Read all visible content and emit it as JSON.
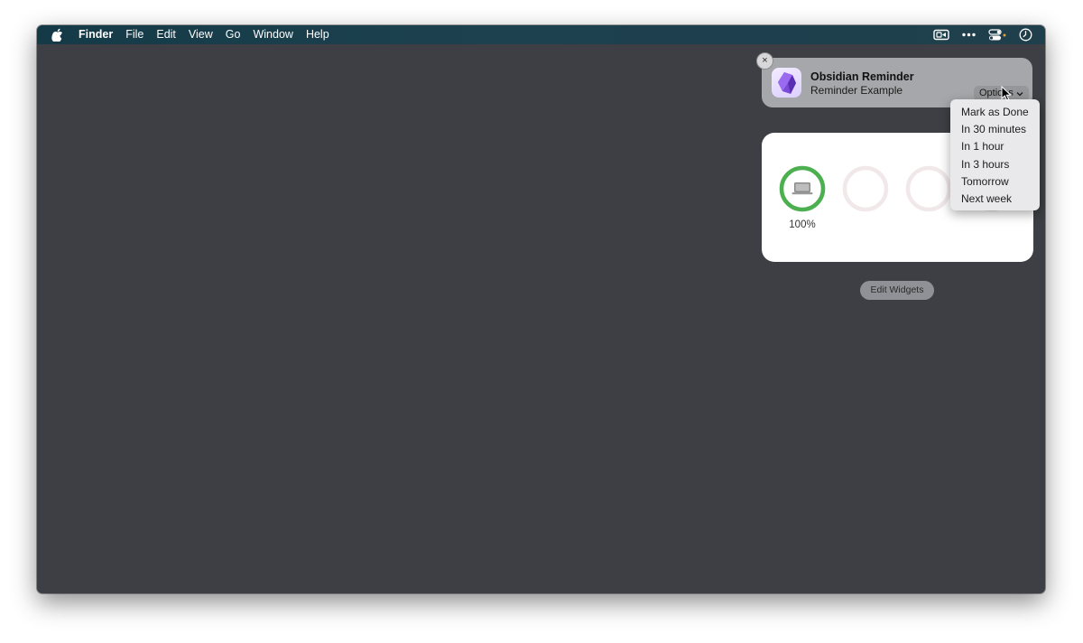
{
  "menubar": {
    "app_name": "Finder",
    "menus": [
      "File",
      "Edit",
      "View",
      "Go",
      "Window",
      "Help"
    ],
    "right_icons": [
      "screen-record-icon",
      "more-icon",
      "control-center-icon",
      "clock-icon"
    ]
  },
  "notification": {
    "app_icon": "obsidian-app-icon",
    "title": "Obsidian Reminder",
    "body": "Reminder Example",
    "options_label": "Options",
    "close_glyph": "×"
  },
  "dropdown": {
    "items": [
      "Mark as Done",
      "In 30 minutes",
      "In 1 hour",
      "In 3 hours",
      "Tomorrow",
      "Next week"
    ]
  },
  "battery_widget": {
    "devices": [
      {
        "icon": "laptop-icon",
        "level": 1.0,
        "label": "100%",
        "color": "#4caf50"
      },
      {
        "icon": "",
        "level": 0,
        "label": ""
      },
      {
        "icon": "",
        "level": 0,
        "label": ""
      }
    ]
  },
  "edit_widgets_label": "Edit Widgets",
  "colors": {
    "desktop": "#3d3f44",
    "menubar": "#1d414f",
    "battery_ring": "#4caf50",
    "empty_ring": "#f1e8ea"
  }
}
